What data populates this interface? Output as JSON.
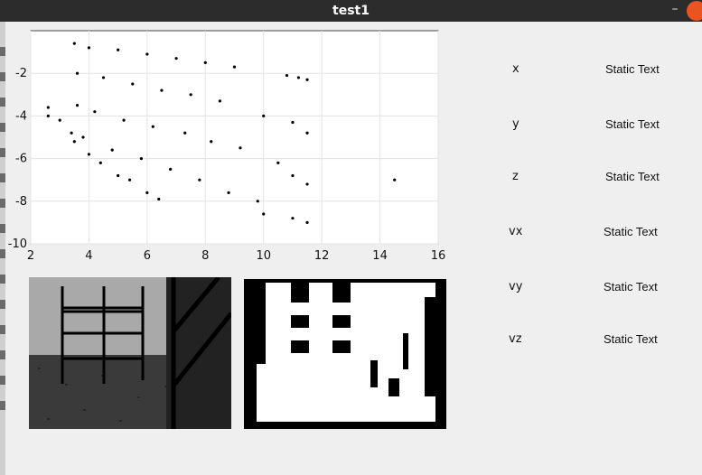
{
  "window": {
    "title": "test1",
    "minimize_glyph": "–"
  },
  "chart_data": {
    "type": "scatter",
    "title": "",
    "xlabel": "",
    "ylabel": "",
    "xlim": [
      2,
      16
    ],
    "ylim": [
      -10,
      0
    ],
    "xticks": [
      "2",
      "4",
      "6",
      "8",
      "10",
      "12",
      "14",
      "16"
    ],
    "yticks": [
      "-2",
      "-4",
      "-6",
      "-8",
      "-10"
    ],
    "grid": true,
    "marker_color": "#000000",
    "series": [
      {
        "points": [
          [
            3.5,
            -0.6
          ],
          [
            4.0,
            -0.8
          ],
          [
            5.0,
            -0.9
          ],
          [
            6.0,
            -1.1
          ],
          [
            7.0,
            -1.3
          ],
          [
            8.0,
            -1.5
          ],
          [
            9.0,
            -1.7
          ],
          [
            3.6,
            -2.0
          ],
          [
            4.5,
            -2.2
          ],
          [
            5.5,
            -2.5
          ],
          [
            6.5,
            -2.8
          ],
          [
            7.5,
            -3.0
          ],
          [
            8.5,
            -3.3
          ],
          [
            3.6,
            -3.5
          ],
          [
            4.2,
            -3.8
          ],
          [
            5.2,
            -4.2
          ],
          [
            6.2,
            -4.5
          ],
          [
            7.3,
            -4.8
          ],
          [
            8.2,
            -5.2
          ],
          [
            9.2,
            -5.5
          ],
          [
            3.8,
            -5.0
          ],
          [
            4.8,
            -5.6
          ],
          [
            5.8,
            -6.0
          ],
          [
            6.8,
            -6.5
          ],
          [
            7.8,
            -7.0
          ],
          [
            8.8,
            -7.6
          ],
          [
            9.8,
            -8.0
          ],
          [
            2.6,
            -3.6
          ],
          [
            3.0,
            -4.2
          ],
          [
            3.5,
            -5.2
          ],
          [
            4.0,
            -5.8
          ],
          [
            5.0,
            -6.8
          ],
          [
            6.0,
            -7.6
          ],
          [
            6.4,
            -7.9
          ],
          [
            2.6,
            -4.0
          ],
          [
            3.4,
            -4.8
          ],
          [
            4.4,
            -6.2
          ],
          [
            5.4,
            -7.0
          ],
          [
            10.0,
            -4.0
          ],
          [
            11.0,
            -4.3
          ],
          [
            11.5,
            -4.8
          ],
          [
            10.5,
            -6.2
          ],
          [
            11.0,
            -6.8
          ],
          [
            11.5,
            -7.2
          ],
          [
            10.0,
            -8.6
          ],
          [
            11.0,
            -8.8
          ],
          [
            11.5,
            -9.0
          ],
          [
            10.8,
            -2.1
          ],
          [
            11.2,
            -2.2
          ],
          [
            11.5,
            -2.3
          ],
          [
            14.5,
            -7.0
          ]
        ]
      }
    ]
  },
  "fields": [
    {
      "label": "x",
      "value": "Static Text"
    },
    {
      "label": "y",
      "value": "Static Text"
    },
    {
      "label": "z",
      "value": "Static Text"
    },
    {
      "label": "vx",
      "value": "Static Text"
    },
    {
      "label": "vy",
      "value": "Static Text"
    },
    {
      "label": "vz",
      "value": "Static Text"
    }
  ]
}
